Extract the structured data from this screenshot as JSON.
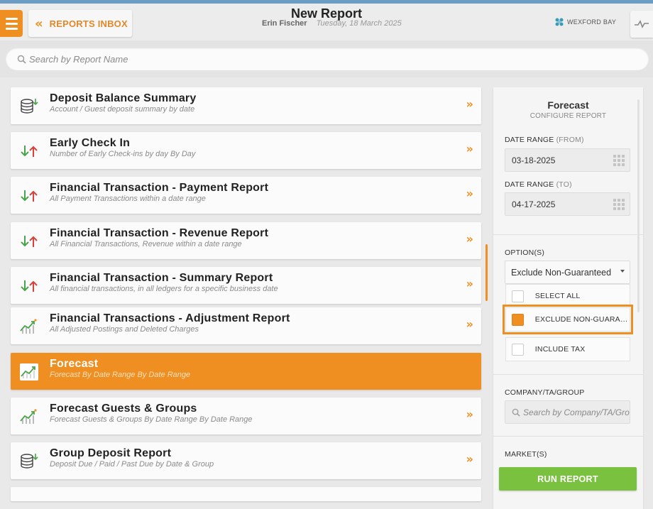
{
  "header": {
    "inbox_label": "REPORTS INBOX",
    "title": "New Report",
    "user_name": "Erin Fischer",
    "date": "Tuesday, 18 March 2025",
    "brand_name": "WEXFORD BAY"
  },
  "search": {
    "placeholder": "Search by Report Name"
  },
  "reports": [
    {
      "title": "Deposit Balance Summary",
      "description": "Account / Guest deposit summary by date",
      "icon": "database-icon"
    },
    {
      "title": "Early Check In",
      "description": "Number of Early Check-ins by day By Day",
      "icon": "arrows-updown-icon"
    },
    {
      "title": "Financial Transaction - Payment Report",
      "description": "All Payment Transactions within a date range",
      "icon": "arrows-updown-icon"
    },
    {
      "title": "Financial Transaction - Revenue Report",
      "description": "All Financial Transactions, Revenue within a date range",
      "icon": "arrows-updown-icon"
    },
    {
      "title": "Financial Transaction - Summary Report",
      "description": "All financial transactions, in all ledgers for a specific business date",
      "icon": "arrows-updown-icon"
    },
    {
      "title": "Financial Transactions - Adjustment Report",
      "description": "All Adjusted Postings and Deleted Charges",
      "icon": "trend-chart-icon"
    },
    {
      "title": "Forecast",
      "description": "Forecast By Date Range By Date Range",
      "icon": "trend-chart-icon",
      "active": true
    },
    {
      "title": "Forecast Guests & Groups",
      "description": "Forecast Guests & Groups By Date Range By Date Range",
      "icon": "trend-chart-icon"
    },
    {
      "title": "Group Deposit Report",
      "description": "Deposit Due / Paid / Past Due by Date & Group",
      "icon": "database-icon"
    }
  ],
  "panel": {
    "title": "Forecast",
    "subtitle": "CONFIGURE REPORT",
    "date_from_label": "DATE RANGE",
    "date_from_suffix": "(FROM)",
    "date_from_value": "03-18-2025",
    "date_to_label": "DATE RANGE",
    "date_to_suffix": "(TO)",
    "date_to_value": "04-17-2025",
    "options_label": "OPTION(S)",
    "options_selected": "Exclude Non-Guaranteed",
    "options": [
      {
        "label": "SELECT ALL",
        "checked": false
      },
      {
        "label": "EXCLUDE NON-GUARANTEED",
        "checked": true
      },
      {
        "label": "INCLUDE TAX",
        "checked": false
      }
    ],
    "company_label": "COMPANY/TA/GROUP",
    "company_placeholder": "Search by Company/TA/Group",
    "market_label": "MARKET(S)",
    "run_label": "RUN REPORT"
  },
  "colors": {
    "accent": "#ef8f22",
    "run": "#7ac13f",
    "topbar": "#6a9cc6"
  }
}
